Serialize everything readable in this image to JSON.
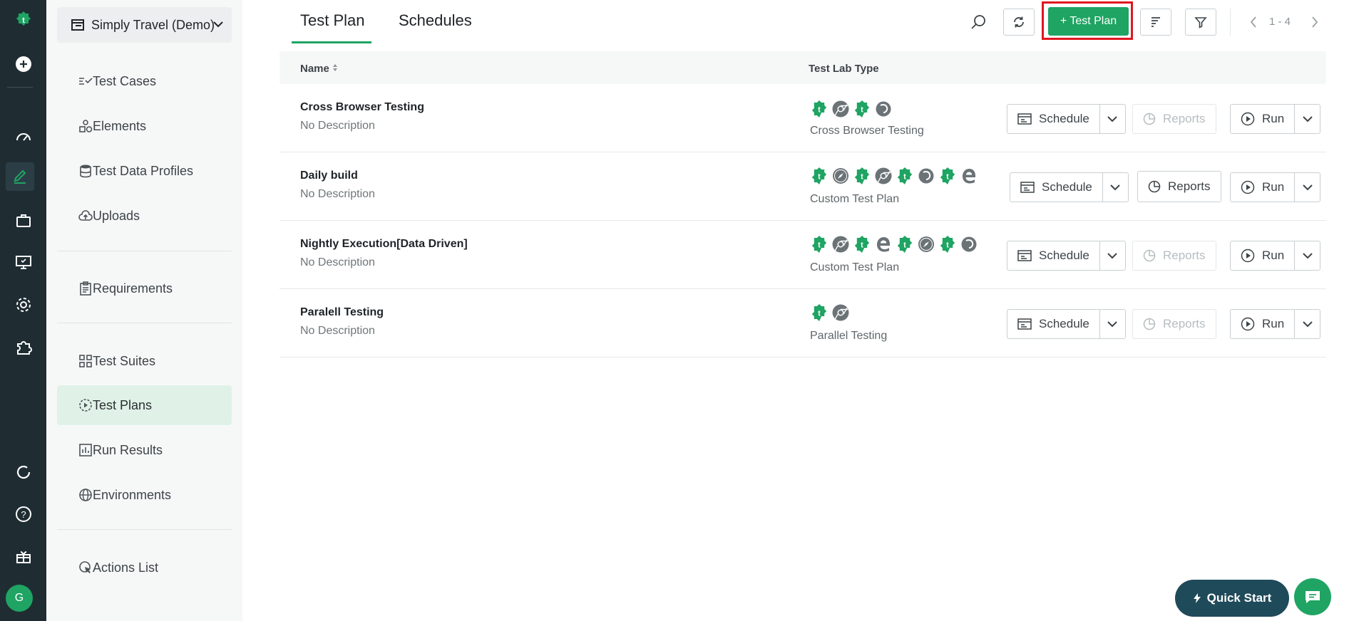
{
  "app": {
    "accent": "#1fa463",
    "rail_bg": "#1f2d33",
    "avatar_letter": "G"
  },
  "sidebar": {
    "project_name": "Simply Travel (Demo)",
    "items": [
      {
        "label": "Test Cases",
        "icon": "test-cases-icon"
      },
      {
        "label": "Elements",
        "icon": "elements-icon"
      },
      {
        "label": "Test Data Profiles",
        "icon": "database-icon"
      },
      {
        "label": "Uploads",
        "icon": "cloud-upload-icon"
      },
      {
        "label": "Requirements",
        "icon": "clipboard-icon"
      },
      {
        "label": "Test Suites",
        "icon": "grid-icon"
      },
      {
        "label": "Test Plans",
        "icon": "play-circle-icon",
        "active": true
      },
      {
        "label": "Run Results",
        "icon": "bar-chart-icon"
      },
      {
        "label": "Environments",
        "icon": "globe-icon"
      },
      {
        "label": "Actions List",
        "icon": "cursor-click-icon"
      }
    ]
  },
  "header": {
    "tabs": [
      "Test Plan",
      "Schedules"
    ],
    "add_button": "+ Test Plan",
    "pagination": "1 - 4"
  },
  "table": {
    "columns": [
      "Name",
      "Test Lab Type"
    ],
    "rows": [
      {
        "name": "Cross Browser Testing",
        "description": "No Description",
        "lab_type": "Cross Browser Testing",
        "browsers": [
          "testsigma",
          "chrome",
          "testsigma",
          "firefox"
        ],
        "reports_enabled": false
      },
      {
        "name": "Daily build",
        "description": "No Description",
        "lab_type": "Custom Test Plan",
        "browsers": [
          "testsigma",
          "safari",
          "testsigma",
          "chrome",
          "testsigma",
          "firefox",
          "testsigma",
          "edge"
        ],
        "reports_enabled": true
      },
      {
        "name": "Nightly Execution[Data Driven]",
        "description": "No Description",
        "lab_type": "Custom Test Plan",
        "browsers": [
          "testsigma",
          "chrome",
          "testsigma",
          "edge",
          "testsigma",
          "safari",
          "testsigma",
          "firefox"
        ],
        "reports_enabled": false
      },
      {
        "name": "Paralell Testing",
        "description": "No Description",
        "lab_type": "Parallel Testing",
        "browsers": [
          "testsigma",
          "chrome"
        ],
        "reports_enabled": false
      }
    ],
    "schedule_label": "Schedule",
    "reports_label": "Reports",
    "run_label": "Run"
  },
  "footer": {
    "quick_start": "Quick Start"
  }
}
